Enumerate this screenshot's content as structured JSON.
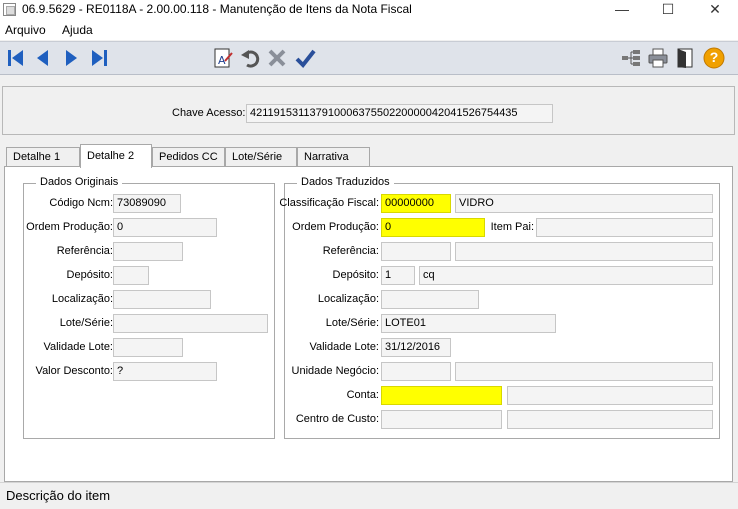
{
  "window": {
    "title": "06.9.5629 - RE0118A - 2.00.00.118 - Manutenção de Itens da Nota Fiscal",
    "minimize_glyph": "—",
    "maximize_glyph": "☐",
    "close_glyph": "✕"
  },
  "menu": {
    "items": [
      "Arquivo",
      "Ajuda"
    ]
  },
  "toolbar": {
    "nav": [
      "first-record-icon",
      "previous-record-icon",
      "next-record-icon",
      "last-record-icon"
    ],
    "actions": [
      "edit-text-icon",
      "undo-icon",
      "cancel-icon",
      "confirm-icon"
    ],
    "right": [
      "tree-icon",
      "print-icon",
      "exit-door-icon",
      "help-icon"
    ],
    "help_glyph": "?",
    "colors": {
      "nav": "#1f5fbf",
      "help": "#f0a000",
      "confirm": "#2a4f9a"
    }
  },
  "header": {
    "chave_label": "Chave Acesso:",
    "chave_value": "42119153113791000637550220000042041526754435"
  },
  "tabs": [
    "Detalhe 1",
    "Detalhe 2",
    "Pedidos CC",
    "Lote/Série",
    "Narrativa"
  ],
  "active_tab": "Detalhe 2",
  "originais": {
    "title": "Dados Originais",
    "codigo_ncm": {
      "label": "Código Ncm:",
      "value": "73089090"
    },
    "ordem_producao": {
      "label": "Ordem Produção:",
      "value": "0"
    },
    "referencia": {
      "label": "Referência:",
      "value": ""
    },
    "deposito": {
      "label": "Depósito:",
      "value": ""
    },
    "localizacao": {
      "label": "Localização:",
      "value": ""
    },
    "lote_serie": {
      "label": "Lote/Série:",
      "value": ""
    },
    "validade_lote": {
      "label": "Validade Lote:",
      "value": ""
    },
    "valor_desconto": {
      "label": "Valor Desconto:",
      "value": "?"
    }
  },
  "traduzidos": {
    "title": "Dados Traduzidos",
    "classificacao_fiscal": {
      "label": "Classificação Fiscal:",
      "value": "00000000",
      "desc": "VIDRO"
    },
    "ordem_producao": {
      "label": "Ordem Produção:",
      "value": "0"
    },
    "item_pai": {
      "label": "Item Pai:",
      "value": ""
    },
    "referencia": {
      "label": "Referência:",
      "value": "",
      "desc": ""
    },
    "deposito": {
      "label": "Depósito:",
      "value": "1",
      "desc": "cq"
    },
    "localizacao": {
      "label": "Localização:",
      "value": ""
    },
    "lote_serie": {
      "label": "Lote/Série:",
      "value": "LOTE01"
    },
    "validade_lote": {
      "label": "Validade Lote:",
      "value": "31/12/2016"
    },
    "unidade_negocio": {
      "label": "Unidade Negócio:",
      "value": "",
      "desc": ""
    },
    "conta": {
      "label": "Conta:",
      "value": "",
      "desc": ""
    },
    "centro_custo": {
      "label": "Centro de Custo:",
      "value": "",
      "desc": ""
    }
  },
  "status": {
    "text": "Descrição do item"
  },
  "colors": {
    "required_field": "#ffff00",
    "toolbar_bg": "#dfe3ea"
  }
}
